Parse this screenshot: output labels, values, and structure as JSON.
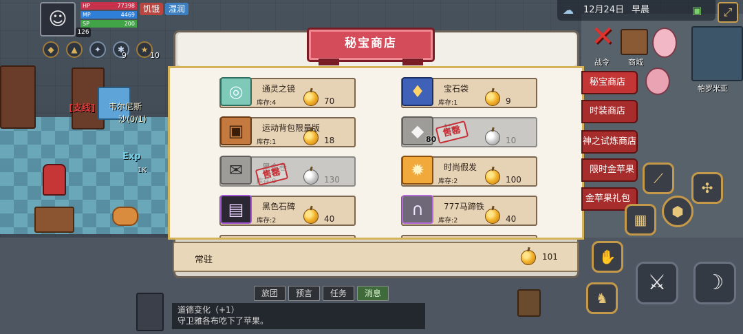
{
  "hud": {
    "hp_label": "HP",
    "hp_value": "77398",
    "mp_label": "MP",
    "mp_value": "4469",
    "sp_label": "SP",
    "sp_value": "200",
    "level": "126",
    "status_hungry": "饥饿",
    "status_wet": "湿润",
    "buff_counts": [
      "9",
      "10"
    ]
  },
  "top_right": {
    "date": "12月24日",
    "period": "早晨",
    "side_labels": [
      "战令",
      "商城"
    ],
    "npc_name": "帕罗米亚"
  },
  "world": {
    "npc_tag": "[支线]",
    "npc_name": "韦尔尼斯",
    "npc_progress": "沙(0/1)",
    "exp_label": "Exp",
    "exp_value": "1K"
  },
  "shop": {
    "title": "秘宝商店",
    "sold_out_label": "售罄",
    "currency_icon": "golden-apple-icon",
    "items": [
      {
        "name": "通灵之镜",
        "stock": "库存:4",
        "price": "70",
        "icon": "mirror-icon",
        "sold_out": false
      },
      {
        "name": "宝石袋",
        "stock": "库存:1",
        "price": "9",
        "icon": "gem-bag-icon",
        "sold_out": false
      },
      {
        "name": "运动背包限量版",
        "stock": "库存:1",
        "price": "18",
        "icon": "backpack-icon",
        "sold_out": false
      },
      {
        "name": "钻",
        "stock": "",
        "price": "10",
        "icon": "diamond-icon",
        "sold_out": true,
        "qty": "80"
      },
      {
        "name": "黑金卷",
        "stock": "库存:0",
        "price": "130",
        "icon": "scroll-icon",
        "sold_out": true
      },
      {
        "name": "时尚假发",
        "stock": "库存:2",
        "price": "100",
        "icon": "wig-icon",
        "sold_out": false
      },
      {
        "name": "黑色石碑",
        "stock": "库存:2",
        "price": "40",
        "icon": "stone-tablet-icon",
        "sold_out": false
      },
      {
        "name": "777马蹄铁",
        "stock": "库存:2",
        "price": "40",
        "icon": "horseshoe-icon",
        "sold_out": false
      }
    ],
    "footer_label": "常驻",
    "currency_balance": "101"
  },
  "tabs": [
    {
      "label": "秘宝商店",
      "active": true
    },
    {
      "label": "时装商店",
      "active": false
    },
    {
      "label": "神之试炼商店",
      "active": false
    },
    {
      "label": "限时金苹果",
      "active": false
    },
    {
      "label": "金苹果礼包",
      "active": false
    }
  ],
  "chat": {
    "tabs": [
      {
        "label": "旅团",
        "active": false
      },
      {
        "label": "预言",
        "active": false
      },
      {
        "label": "任务",
        "active": false
      },
      {
        "label": "消息",
        "active": true
      }
    ],
    "lines": [
      "道德变化（+1）",
      "守卫雅各布吃下了苹果。"
    ]
  },
  "colors": {
    "tab_red": "#a72c2c",
    "banner_red": "#d44c5a",
    "panel_gold": "#d4b35a",
    "item_tan": "#e6d3b6"
  }
}
